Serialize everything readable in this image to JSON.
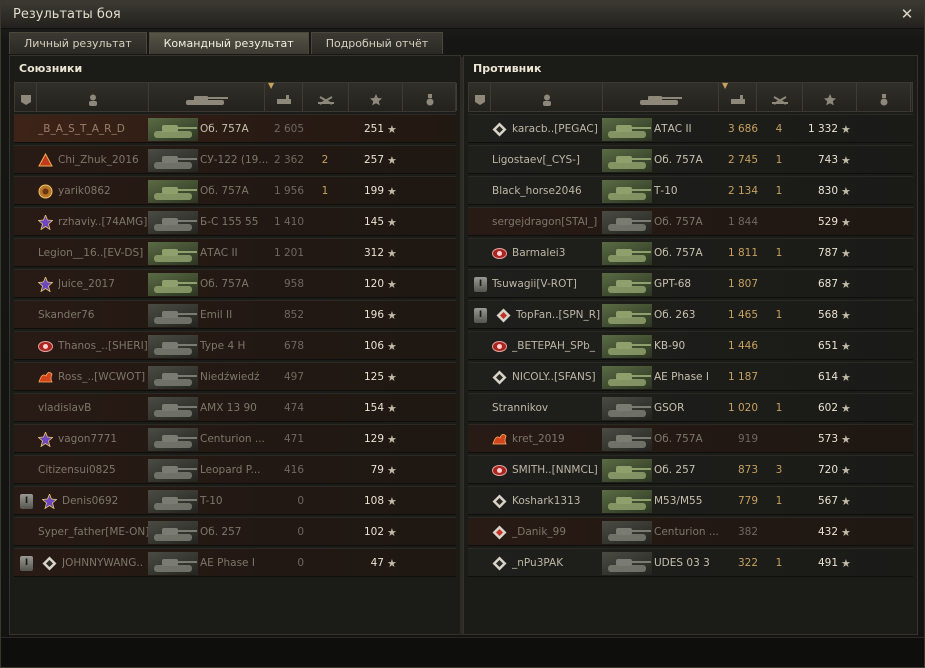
{
  "window": {
    "title": "Результаты боя"
  },
  "tabs": [
    "Личный результат",
    "Командный результат",
    "Подробный отчёт"
  ],
  "active_tab": 1,
  "allies": {
    "title": "Союзники",
    "rows": [
      {
        "name": "_B_A_S_T_A_R_D",
        "vehicle": "Об. 757А",
        "damage": "2 605",
        "frags": "",
        "xp": "251",
        "state": "self",
        "badge": "",
        "platoon": "",
        "tank": "green"
      },
      {
        "name": "Chi_Zhuk_2016",
        "vehicle": "СУ-122 (19...",
        "damage": "2 362",
        "frags": "2",
        "xp": "257",
        "state": "dead",
        "badge": "red-triangle",
        "platoon": "",
        "tank": "gray"
      },
      {
        "name": "yarik0862",
        "vehicle": "Об. 757А",
        "damage": "1 956",
        "frags": "1",
        "xp": "199",
        "state": "dead",
        "badge": "gold-emblem",
        "platoon": "",
        "tank": "green"
      },
      {
        "name": "rzhaviy..[74AMG]",
        "vehicle": "Б-С 155 55",
        "damage": "1 410",
        "frags": "",
        "xp": "145",
        "state": "dead",
        "badge": "purple-emblem",
        "platoon": "",
        "tank": "gray"
      },
      {
        "name": "Legion__16..[EV-DS]",
        "vehicle": "АТАС II",
        "damage": "1 201",
        "frags": "",
        "xp": "312",
        "state": "dead",
        "badge": "",
        "platoon": "",
        "tank": "green"
      },
      {
        "name": "Juice_2017",
        "vehicle": "Об. 757А",
        "damage": "958",
        "frags": "",
        "xp": "120",
        "state": "dead",
        "badge": "purple-emblem",
        "platoon": "",
        "tank": "green"
      },
      {
        "name": "Skander76",
        "vehicle": "Emil II",
        "damage": "852",
        "frags": "",
        "xp": "196",
        "state": "dead",
        "badge": "",
        "platoon": "",
        "tank": "gray"
      },
      {
        "name": "Thanos_..[SHERI]",
        "vehicle": "Type 4 H",
        "damage": "678",
        "frags": "",
        "xp": "106",
        "state": "dead",
        "badge": "red-emblem",
        "platoon": "",
        "tank": "gray"
      },
      {
        "name": "Ross_..[WCWOT]",
        "vehicle": "Niedźwiedź",
        "damage": "497",
        "frags": "",
        "xp": "125",
        "state": "dead",
        "badge": "fire-emblem",
        "platoon": "",
        "tank": "gray"
      },
      {
        "name": "vladislavB",
        "vehicle": "AMX 13 90",
        "damage": "474",
        "frags": "",
        "xp": "154",
        "state": "dead",
        "badge": "",
        "platoon": "",
        "tank": "gray"
      },
      {
        "name": "vagon7771",
        "vehicle": "Centurion ...",
        "damage": "471",
        "frags": "",
        "xp": "129",
        "state": "dead",
        "badge": "purple-emblem",
        "platoon": "",
        "tank": "gray"
      },
      {
        "name": "Citizensui0825",
        "vehicle": "Leopard P...",
        "damage": "416",
        "frags": "",
        "xp": "79",
        "state": "dead",
        "badge": "",
        "platoon": "",
        "tank": "gray"
      },
      {
        "name": "Denis0692",
        "vehicle": "T-10",
        "damage": "0",
        "frags": "",
        "xp": "108",
        "state": "dead",
        "badge": "purple-emblem",
        "platoon": "I",
        "tank": "gray"
      },
      {
        "name": "Syper_father[ME-ON]",
        "vehicle": "Об. 257",
        "damage": "0",
        "frags": "",
        "xp": "102",
        "state": "dead",
        "badge": "",
        "platoon": "",
        "tank": "gray"
      },
      {
        "name": "JOHNNYWANG..",
        "vehicle": "AE Phase I",
        "damage": "0",
        "frags": "",
        "xp": "47",
        "state": "dead",
        "badge": "white-diamond",
        "platoon": "I",
        "tank": "gray"
      }
    ]
  },
  "enemies": {
    "title": "Противник",
    "rows": [
      {
        "name": "karacb..[PEGAC]",
        "vehicle": "АТАС II",
        "damage": "3 686",
        "frags": "4",
        "xp": "1 332",
        "state": "alive",
        "badge": "white-diamond",
        "platoon": "",
        "tank": "green"
      },
      {
        "name": "Ligostaev[_CYS-]",
        "vehicle": "Об. 757А",
        "damage": "2 745",
        "frags": "1",
        "xp": "743",
        "state": "alive",
        "badge": "",
        "platoon": "",
        "tank": "green"
      },
      {
        "name": "Black_horse2046",
        "vehicle": "Т-10",
        "damage": "2 134",
        "frags": "1",
        "xp": "830",
        "state": "alive",
        "badge": "",
        "platoon": "",
        "tank": "green"
      },
      {
        "name": "sergejdragon[STAI_]",
        "vehicle": "Об. 757А",
        "damage": "1 844",
        "frags": "",
        "xp": "529",
        "state": "dead",
        "badge": "",
        "platoon": "",
        "tank": "gray"
      },
      {
        "name": "Barmalei3",
        "vehicle": "Об. 757А",
        "damage": "1 811",
        "frags": "1",
        "xp": "787",
        "state": "alive",
        "badge": "red-emblem",
        "platoon": "",
        "tank": "green"
      },
      {
        "name": "Tsuwagii[V-ROT]",
        "vehicle": "GPT-68",
        "damage": "1 807",
        "frags": "",
        "xp": "687",
        "state": "alive",
        "badge": "",
        "platoon": "I",
        "tank": "green"
      },
      {
        "name": "TopFan..[SPN_R]",
        "vehicle": "Об. 263",
        "damage": "1 465",
        "frags": "1",
        "xp": "568",
        "state": "alive",
        "badge": "red-diamond",
        "platoon": "I",
        "tank": "green"
      },
      {
        "name": "_BETEPAH_SPb_",
        "vehicle": "KB-90",
        "damage": "1 446",
        "frags": "",
        "xp": "651",
        "state": "alive",
        "badge": "red-emblem",
        "platoon": "",
        "tank": "green"
      },
      {
        "name": "NICOLY..[SFANS]",
        "vehicle": "AE Phase I",
        "damage": "1 187",
        "frags": "",
        "xp": "614",
        "state": "alive",
        "badge": "white-diamond",
        "platoon": "",
        "tank": "green"
      },
      {
        "name": "Strannikov",
        "vehicle": "GSOR",
        "damage": "1 020",
        "frags": "1",
        "xp": "602",
        "state": "alive",
        "badge": "",
        "platoon": "",
        "tank": "gray"
      },
      {
        "name": "kret_2019",
        "vehicle": "Об. 757А",
        "damage": "919",
        "frags": "",
        "xp": "573",
        "state": "dead",
        "badge": "fire-emblem",
        "platoon": "",
        "tank": "gray"
      },
      {
        "name": "SMITH..[NNMCL]",
        "vehicle": "Об. 257",
        "damage": "873",
        "frags": "3",
        "xp": "720",
        "state": "alive",
        "badge": "red-emblem",
        "platoon": "",
        "tank": "green"
      },
      {
        "name": "Koshark1313",
        "vehicle": "M53/M55",
        "damage": "779",
        "frags": "1",
        "xp": "567",
        "state": "alive",
        "badge": "white-diamond",
        "platoon": "",
        "tank": "green"
      },
      {
        "name": "_Danik_99",
        "vehicle": "Centurion ...",
        "damage": "382",
        "frags": "",
        "xp": "432",
        "state": "dead",
        "badge": "red-diamond",
        "platoon": "",
        "tank": "gray"
      },
      {
        "name": "_nPu3PAK",
        "vehicle": "UDES 03 3",
        "damage": "322",
        "frags": "1",
        "xp": "491",
        "state": "alive",
        "badge": "white-diamond",
        "platoon": "",
        "tank": "gray"
      }
    ]
  },
  "column_icons": [
    "platoon-icon",
    "player-icon",
    "vehicle-icon",
    "damage-icon",
    "frags-icon",
    "xp-star-icon",
    "medal-icon"
  ],
  "colors": {
    "damage": "#c6a15f",
    "self_row": "#3e2418",
    "tank_green": "#5a6b44"
  }
}
